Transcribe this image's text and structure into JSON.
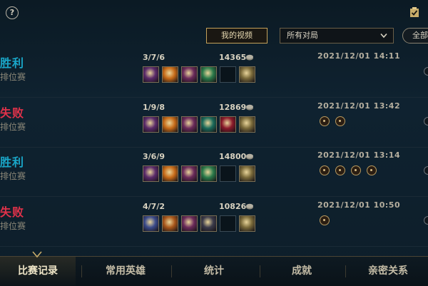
{
  "top": {
    "help_icon": "question-circle",
    "help_label": "?",
    "quest_icon": "checklist-icon",
    "my_video_label": "我的视频",
    "match_filter": {
      "selected": "所有对局"
    },
    "all_label": "全部"
  },
  "matches": [
    {
      "result": "胜利",
      "outcome": "win",
      "mode": "排位赛",
      "kda": "3/7/6",
      "gold": "14365",
      "date": "2021/12/01 14:11",
      "badges": 0
    },
    {
      "result": "失败",
      "outcome": "loss",
      "mode": "排位赛",
      "kda": "1/9/8",
      "gold": "12869",
      "date": "2021/12/01 13:42",
      "badges": 2
    },
    {
      "result": "胜利",
      "outcome": "win",
      "mode": "排位赛",
      "kda": "3/6/9",
      "gold": "14800",
      "date": "2021/12/01 13:14",
      "badges": 4
    },
    {
      "result": "失败",
      "outcome": "loss",
      "mode": "排位赛",
      "kda": "4/7/2",
      "gold": "10826",
      "date": "2021/12/01 10:50",
      "badges": 1
    }
  ],
  "tabs": [
    {
      "label": "比赛记录",
      "active": true
    },
    {
      "label": "常用英雄",
      "active": false
    },
    {
      "label": "统计",
      "active": false
    },
    {
      "label": "成就",
      "active": false
    },
    {
      "label": "亲密关系",
      "active": false
    }
  ],
  "colors": {
    "win": "#1aa6c8",
    "loss": "#e0324a",
    "gold_border": "#c4a15a"
  }
}
